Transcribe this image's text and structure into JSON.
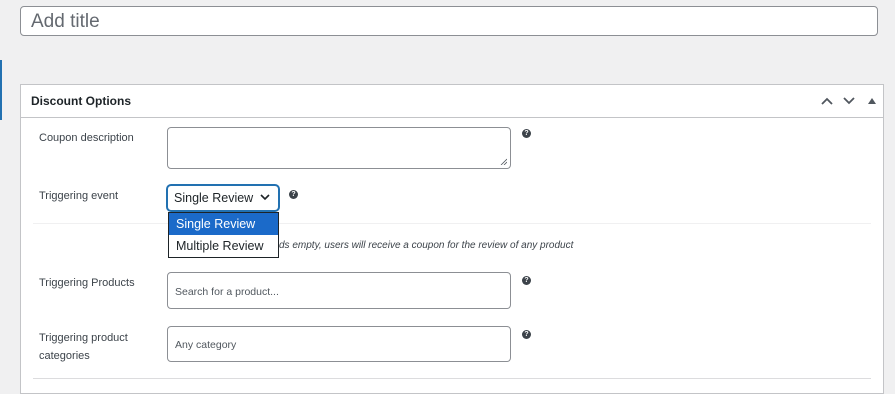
{
  "title_field": {
    "placeholder": "Add title"
  },
  "metabox": {
    "title": "Discount Options",
    "controls": [
      "chevron-up-icon",
      "chevron-down-icon",
      "triangle-up-icon"
    ]
  },
  "fields": {
    "coupon_description": {
      "label": "Coupon description",
      "value": ""
    },
    "triggering_event": {
      "label": "Triggering event",
      "selected": "Single Review",
      "options": [
        "Single Review",
        "Multiple Review"
      ],
      "note": "ds empty, users will receive a coupon for the review of any product"
    },
    "triggering_products": {
      "label": "Triggering Products",
      "placeholder": "Search for a product..."
    },
    "triggering_categories": {
      "label_line1": "Triggering product",
      "label_line2": "categories",
      "placeholder": "Any category"
    }
  },
  "help_glyph": "?",
  "colors": {
    "accent": "#2271b1",
    "selected_option": "#1b6ac9",
    "background": "#f0f0f1"
  }
}
